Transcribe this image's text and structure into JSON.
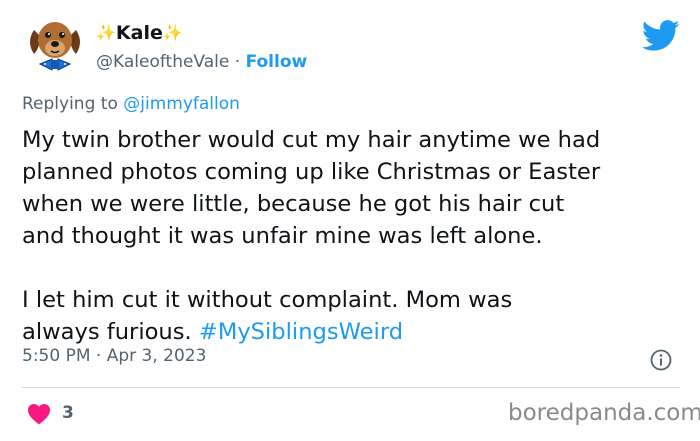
{
  "author": {
    "name": "Kale",
    "name_prefix": "✨",
    "name_suffix": "✨",
    "handle": "@KaleoftheVale",
    "separator": "·",
    "follow_label": "Follow",
    "avatar_icon": "dog-avatar-icon"
  },
  "reply": {
    "prefix": "Replying to",
    "mention": "@jimmyfallon"
  },
  "tweet": {
    "lines": [
      "My twin brother would cut my hair anytime we had",
      "planned photos coming up like Christmas or Easter",
      "when we were little, because he got his hair cut",
      "and thought it was unfair mine was left alone.",
      "",
      "I let him cut it without complaint.  Mom was",
      "always furious. "
    ],
    "hashtag": "#MySiblingsWeird"
  },
  "meta": {
    "time": "5:50 PM",
    "separator": "·",
    "date": "Apr 3, 2023",
    "info_icon": "info-icon"
  },
  "engagement": {
    "likes": "3",
    "like_icon": "heart-icon"
  },
  "platform_icon": "twitter-bird-icon",
  "watermark": "boredpanda.com",
  "colors": {
    "link_blue": "#1d9bf0",
    "text": "#0f1419",
    "secondary": "#536471",
    "heart": "#f91880",
    "sparkle": "#f5b400"
  }
}
